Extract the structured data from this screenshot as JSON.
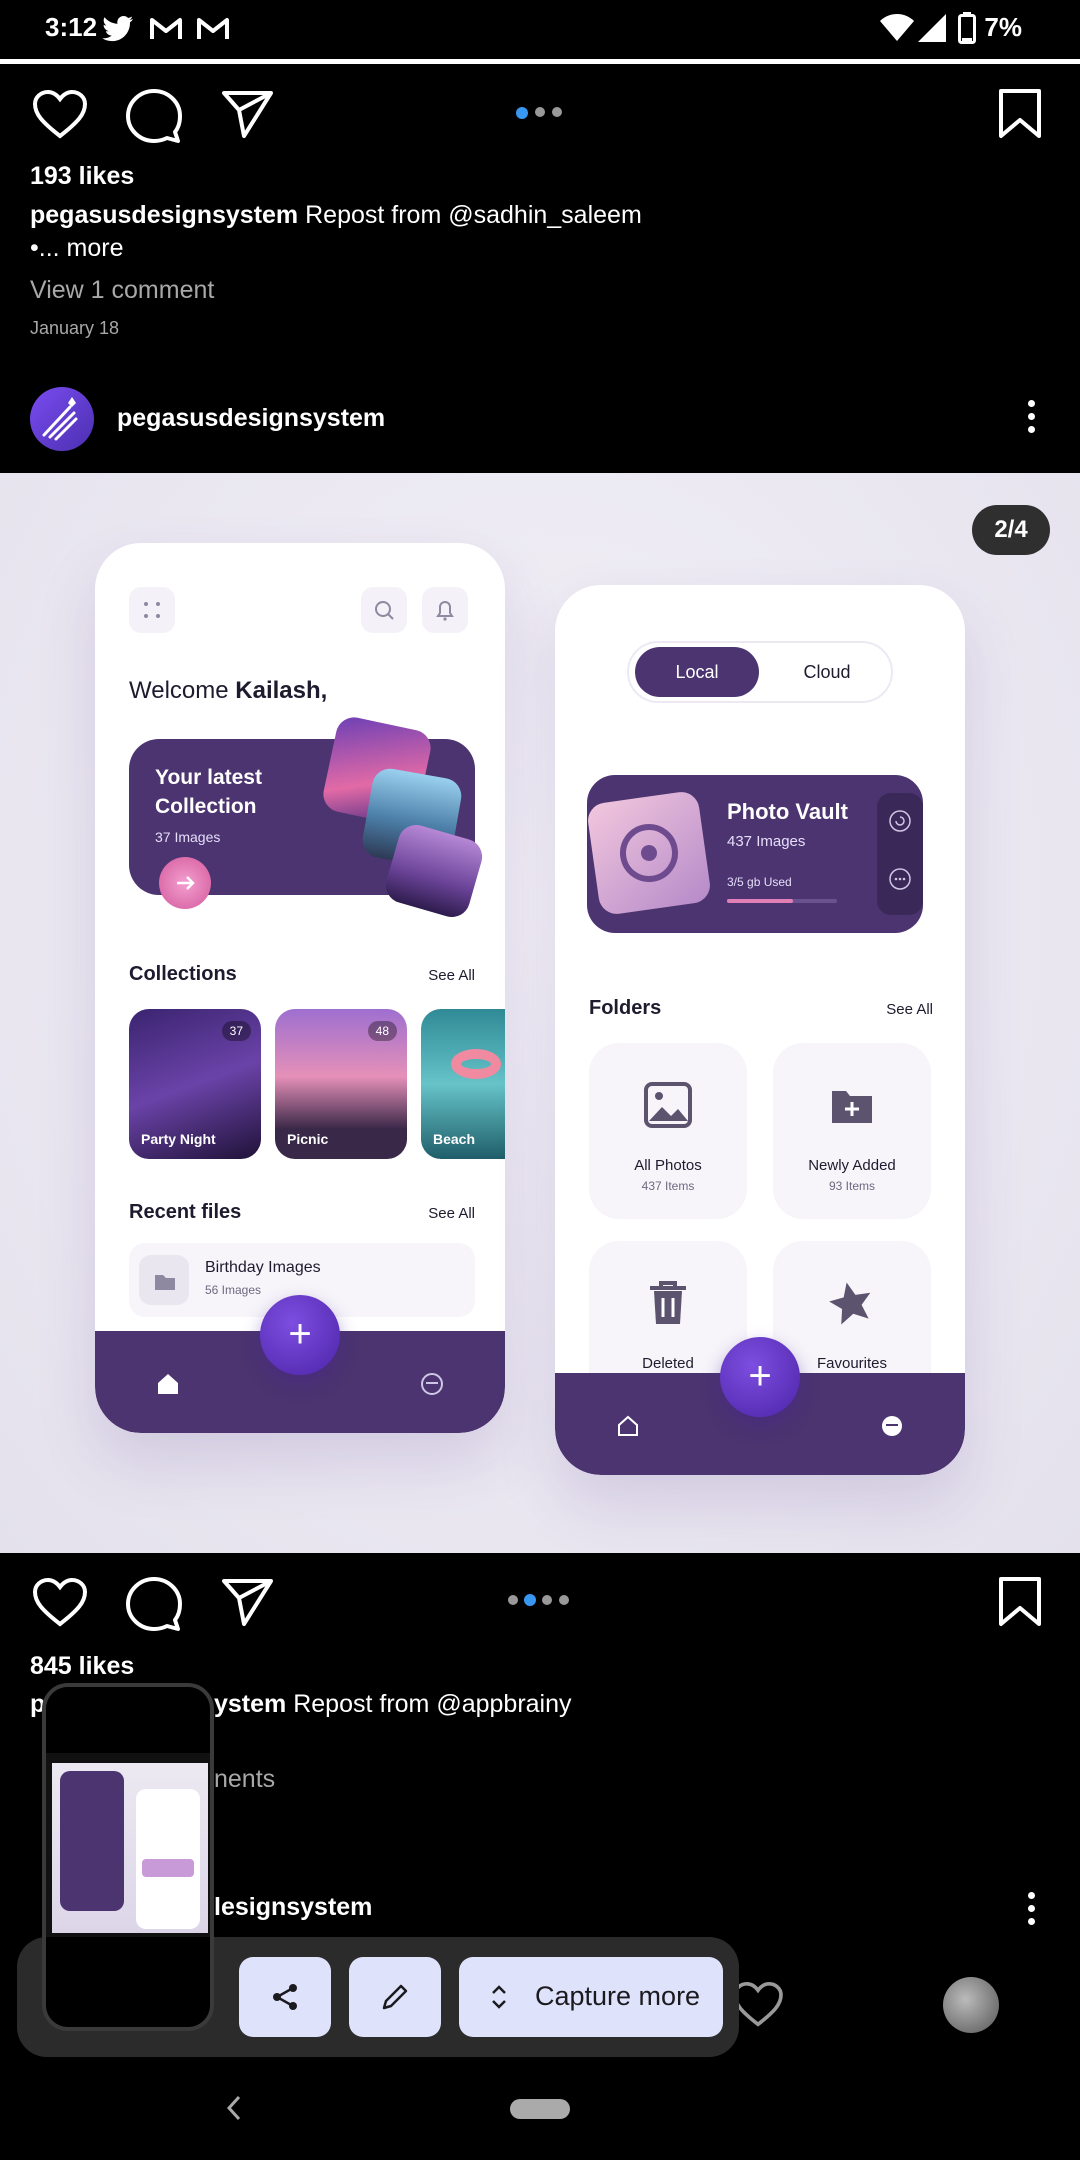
{
  "status": {
    "time": "3:12",
    "battery": "7%",
    "notification_icons": [
      "twitter-icon",
      "gmail-icon",
      "gmail-icon"
    ]
  },
  "post1": {
    "likes": "193 likes",
    "author": "pegasusdesignsystem",
    "caption": "Repost from @sadhin_saleem",
    "more": "•... more",
    "comments": "View 1 comment",
    "date": "January 18"
  },
  "post2": {
    "author": "pegasusdesignsystem",
    "counter": "2/4",
    "likes": "845 likes",
    "caption_author_partial": "p",
    "caption_author_tail": "ystem",
    "caption": "Repost from @appbrainy",
    "comments_partial": "nents",
    "next_author_partial": "lesignsystem"
  },
  "mock_left": {
    "welcome": "Welcome ",
    "user": "Kailash,",
    "card_title_1": "Your latest",
    "card_title_2": "Collection",
    "card_count": "37 Images",
    "collections": "Collections",
    "see_all": "See All",
    "thumbs": [
      {
        "label": "Party Night",
        "badge": "37"
      },
      {
        "label": "Picnic",
        "badge": "48"
      },
      {
        "label": "Beach",
        "badge": ""
      }
    ],
    "recent": "Recent files",
    "recent_see_all": "See All",
    "file_title": "Birthday Images",
    "file_count": "56 Images"
  },
  "mock_right": {
    "tab_local": "Local",
    "tab_cloud": "Cloud",
    "vault_title": "Photo Vault",
    "vault_count": "437 Images",
    "vault_used": "3/5 gb Used",
    "vault_used_fraction": 0.6,
    "folders": "Folders",
    "see_all": "See All",
    "folder_items": [
      {
        "title": "All Photos",
        "sub": "437 Items"
      },
      {
        "title": "Newly Added",
        "sub": "93 Items"
      },
      {
        "title": "Deleted",
        "sub": ""
      },
      {
        "title": "Favourites",
        "sub": ""
      }
    ]
  },
  "capture": {
    "capture_more": "Capture more"
  },
  "colors": {
    "mock_purple": "#4b3470",
    "fab_purple": "#5a2fbf",
    "capture_button": "#dfe2fb",
    "carousel_active": "#3897f0"
  }
}
